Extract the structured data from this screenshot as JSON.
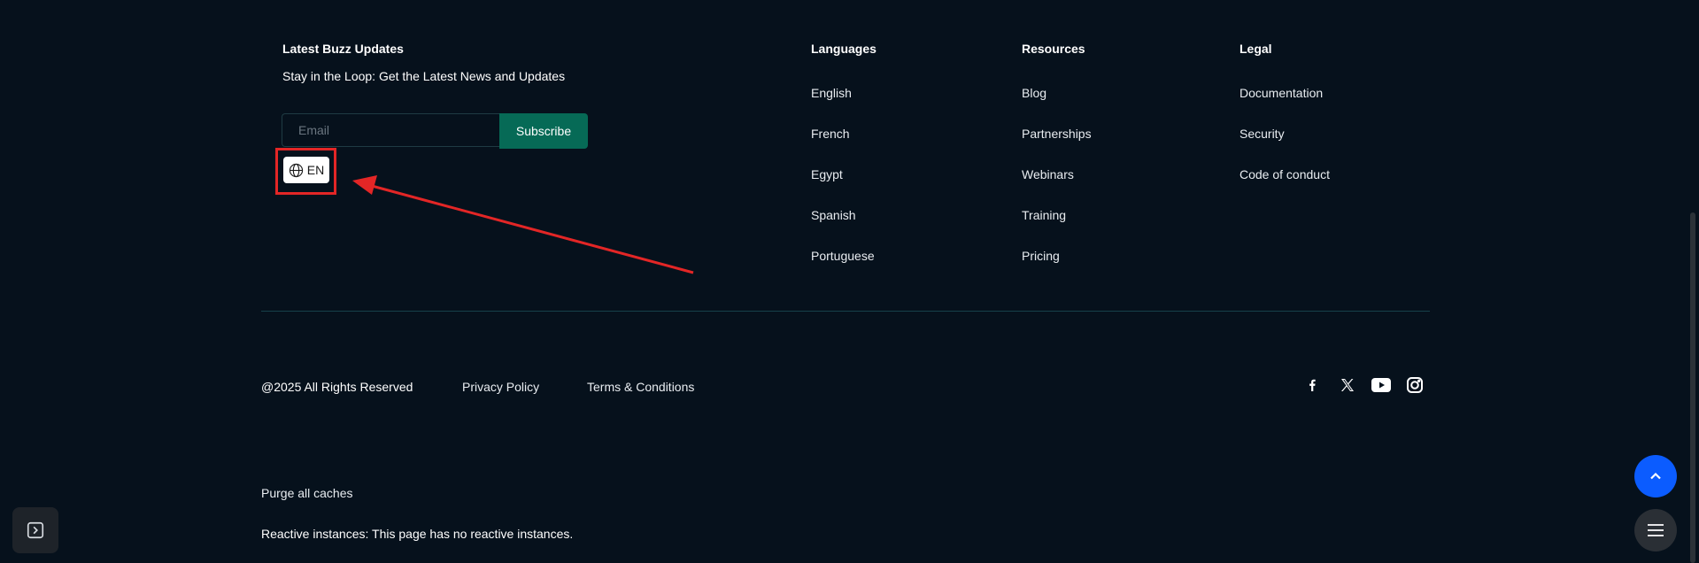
{
  "newsletter": {
    "heading": "Latest Buzz Updates",
    "subtitle": "Stay in the Loop: Get the Latest News and Updates",
    "email_placeholder": "Email",
    "subscribe_label": "Subscribe",
    "language_code": "EN"
  },
  "columns": {
    "languages": {
      "heading": "Languages",
      "items": [
        "English",
        "French",
        "Egypt",
        "Spanish",
        "Portuguese"
      ]
    },
    "resources": {
      "heading": "Resources",
      "items": [
        "Blog",
        "Partnerships",
        "Webinars",
        "Training",
        "Pricing"
      ]
    },
    "legal": {
      "heading": "Legal",
      "items": [
        "Documentation",
        "Security",
        "Code of conduct"
      ]
    }
  },
  "bottom": {
    "copyright": "@2025 All Rights Reserved",
    "privacy": "Privacy Policy",
    "terms": "Terms & Conditions",
    "social": [
      "facebook-icon",
      "x-icon",
      "youtube-icon",
      "instagram-icon"
    ]
  },
  "debug": {
    "purge": "Purge all caches",
    "reactive": "Reactive instances: This page has no reactive instances."
  },
  "colors": {
    "background": "#06111c",
    "subscribe": "#066a56",
    "scroll_top": "#0b5cff",
    "annotation": "#e32626"
  }
}
